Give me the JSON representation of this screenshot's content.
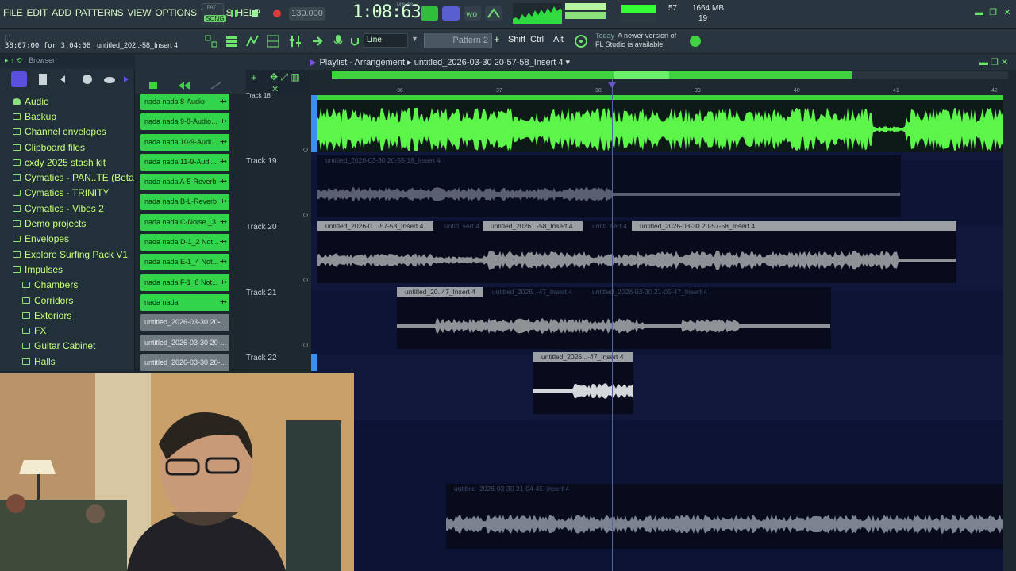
{
  "menu": [
    "FILE",
    "EDIT",
    "ADD",
    "PATTERNS",
    "VIEW",
    "OPTIONS",
    "TOOLS",
    "HELP"
  ],
  "transport": {
    "mode_top": "PAT",
    "mode_bottom": "SONG",
    "tempo": "130.000",
    "time": "1:08:63",
    "time_unit": "M:S:CS"
  },
  "perf": {
    "cpu": "57",
    "memory": "1664 MB",
    "polyphony": "19"
  },
  "hint": {
    "bracket": "[ ]",
    "time": "38:07:00 for 3:04:08",
    "clip": "untitled_202..-58_Insert 4"
  },
  "toolbar": {
    "snap": "Line",
    "pattern": "Pattern 2",
    "shift": "Shift",
    "ctrl": "Ctrl",
    "alt": "Alt",
    "news_today": "Today",
    "news_line1": "A newer version of",
    "news_line2": "FL Studio is available!"
  },
  "browser": {
    "title": "Browser",
    "items": [
      {
        "label": "Audio",
        "icon": "audio-icon"
      },
      {
        "label": "Backup",
        "icon": "folder-icon"
      },
      {
        "label": "Channel envelopes",
        "icon": "folder-icon"
      },
      {
        "label": "Clipboard files",
        "icon": "folder-icon"
      },
      {
        "label": "cxdy 2025 stash kit",
        "icon": "folder-icon"
      },
      {
        "label": "Cymatics - PAN..TE (Beta Pack)",
        "icon": "folder-icon"
      },
      {
        "label": "Cymatics - TRINITY",
        "icon": "folder-icon"
      },
      {
        "label": "Cymatics - Vibes 2",
        "icon": "folder-icon"
      },
      {
        "label": "Demo projects",
        "icon": "folder-icon"
      },
      {
        "label": "Envelopes",
        "icon": "folder-icon"
      },
      {
        "label": "Explore Surfing Pack V1",
        "icon": "folder-icon"
      },
      {
        "label": "Impulses",
        "icon": "folder-icon"
      },
      {
        "label": "Chambers",
        "icon": "folder-icon"
      },
      {
        "label": "Corridors",
        "icon": "folder-icon"
      },
      {
        "label": "Exteriors",
        "icon": "folder-icon"
      },
      {
        "label": "FX",
        "icon": "folder-icon"
      },
      {
        "label": "Guitar Cabinet",
        "icon": "folder-icon"
      },
      {
        "label": "Halls",
        "icon": "folder-icon"
      }
    ]
  },
  "picker": {
    "items": [
      {
        "label": "nada nada 8-Audio",
        "type": "green"
      },
      {
        "label": "nada nada 9-8-Audio...",
        "type": "green"
      },
      {
        "label": "nada nada 10-9-Audi...",
        "type": "green"
      },
      {
        "label": "nada nada 11-9-Audi...",
        "type": "green"
      },
      {
        "label": "nada nada A-5-Reverb",
        "type": "green"
      },
      {
        "label": "nada nada B-L-Reverb",
        "type": "green"
      },
      {
        "label": "nada nada C-Noise _3",
        "type": "green"
      },
      {
        "label": "nada nada D-1_2 Not...",
        "type": "green"
      },
      {
        "label": "nada nada E-1_4 Not...",
        "type": "green"
      },
      {
        "label": "nada nada F-1_8 Not...",
        "type": "green"
      },
      {
        "label": "nada nada",
        "type": "green"
      },
      {
        "label": "untitled_2026-03-30 20-...",
        "type": "grey"
      },
      {
        "label": "untitled_2026-03-30 20-...",
        "type": "grey"
      },
      {
        "label": "untitled_2026-03-30 20-...",
        "type": "grey"
      }
    ]
  },
  "playlist": {
    "title": "Playlist - Arrangement",
    "project": "untitled_2026-03-30 20-57-58_Insert 4",
    "bars": [
      "36",
      "37",
      "38",
      "39",
      "40",
      "41",
      "42"
    ],
    "tracks": [
      {
        "label": "Track 18"
      },
      {
        "label": "Track 19"
      },
      {
        "label": "Track 20"
      },
      {
        "label": "Track 21"
      },
      {
        "label": "Track 22"
      }
    ],
    "clips": {
      "t18": "nada nada",
      "t19": "untitled_2026-03-30 20-55-18_Insert 4",
      "t20a": "untitled_2026-0...-57-58_Insert 4",
      "t20b": "untitl..sert 4",
      "t20c": "untitled_2026...-58_Insert 4",
      "t20d": "untitl..sert 4",
      "t20e": "untitled_2026-03-30 20-57-58_Insert 4",
      "t21a": "untitled_20..47_Insert 4",
      "t21b": "untitled_2026..-47_Insert 4",
      "t21c": "untitled_2026-03-30 21-05-47_Insert 4",
      "t22": "untitled_2026...-47_Insert 4",
      "t24": "untitled_2026-03-30 21-04-45_Insert 4"
    }
  },
  "colors": {
    "accent": "#3fd43f",
    "lane": "#0c1233",
    "wave_green": "#5cf54a",
    "wave_grey": "#8c9296"
  }
}
